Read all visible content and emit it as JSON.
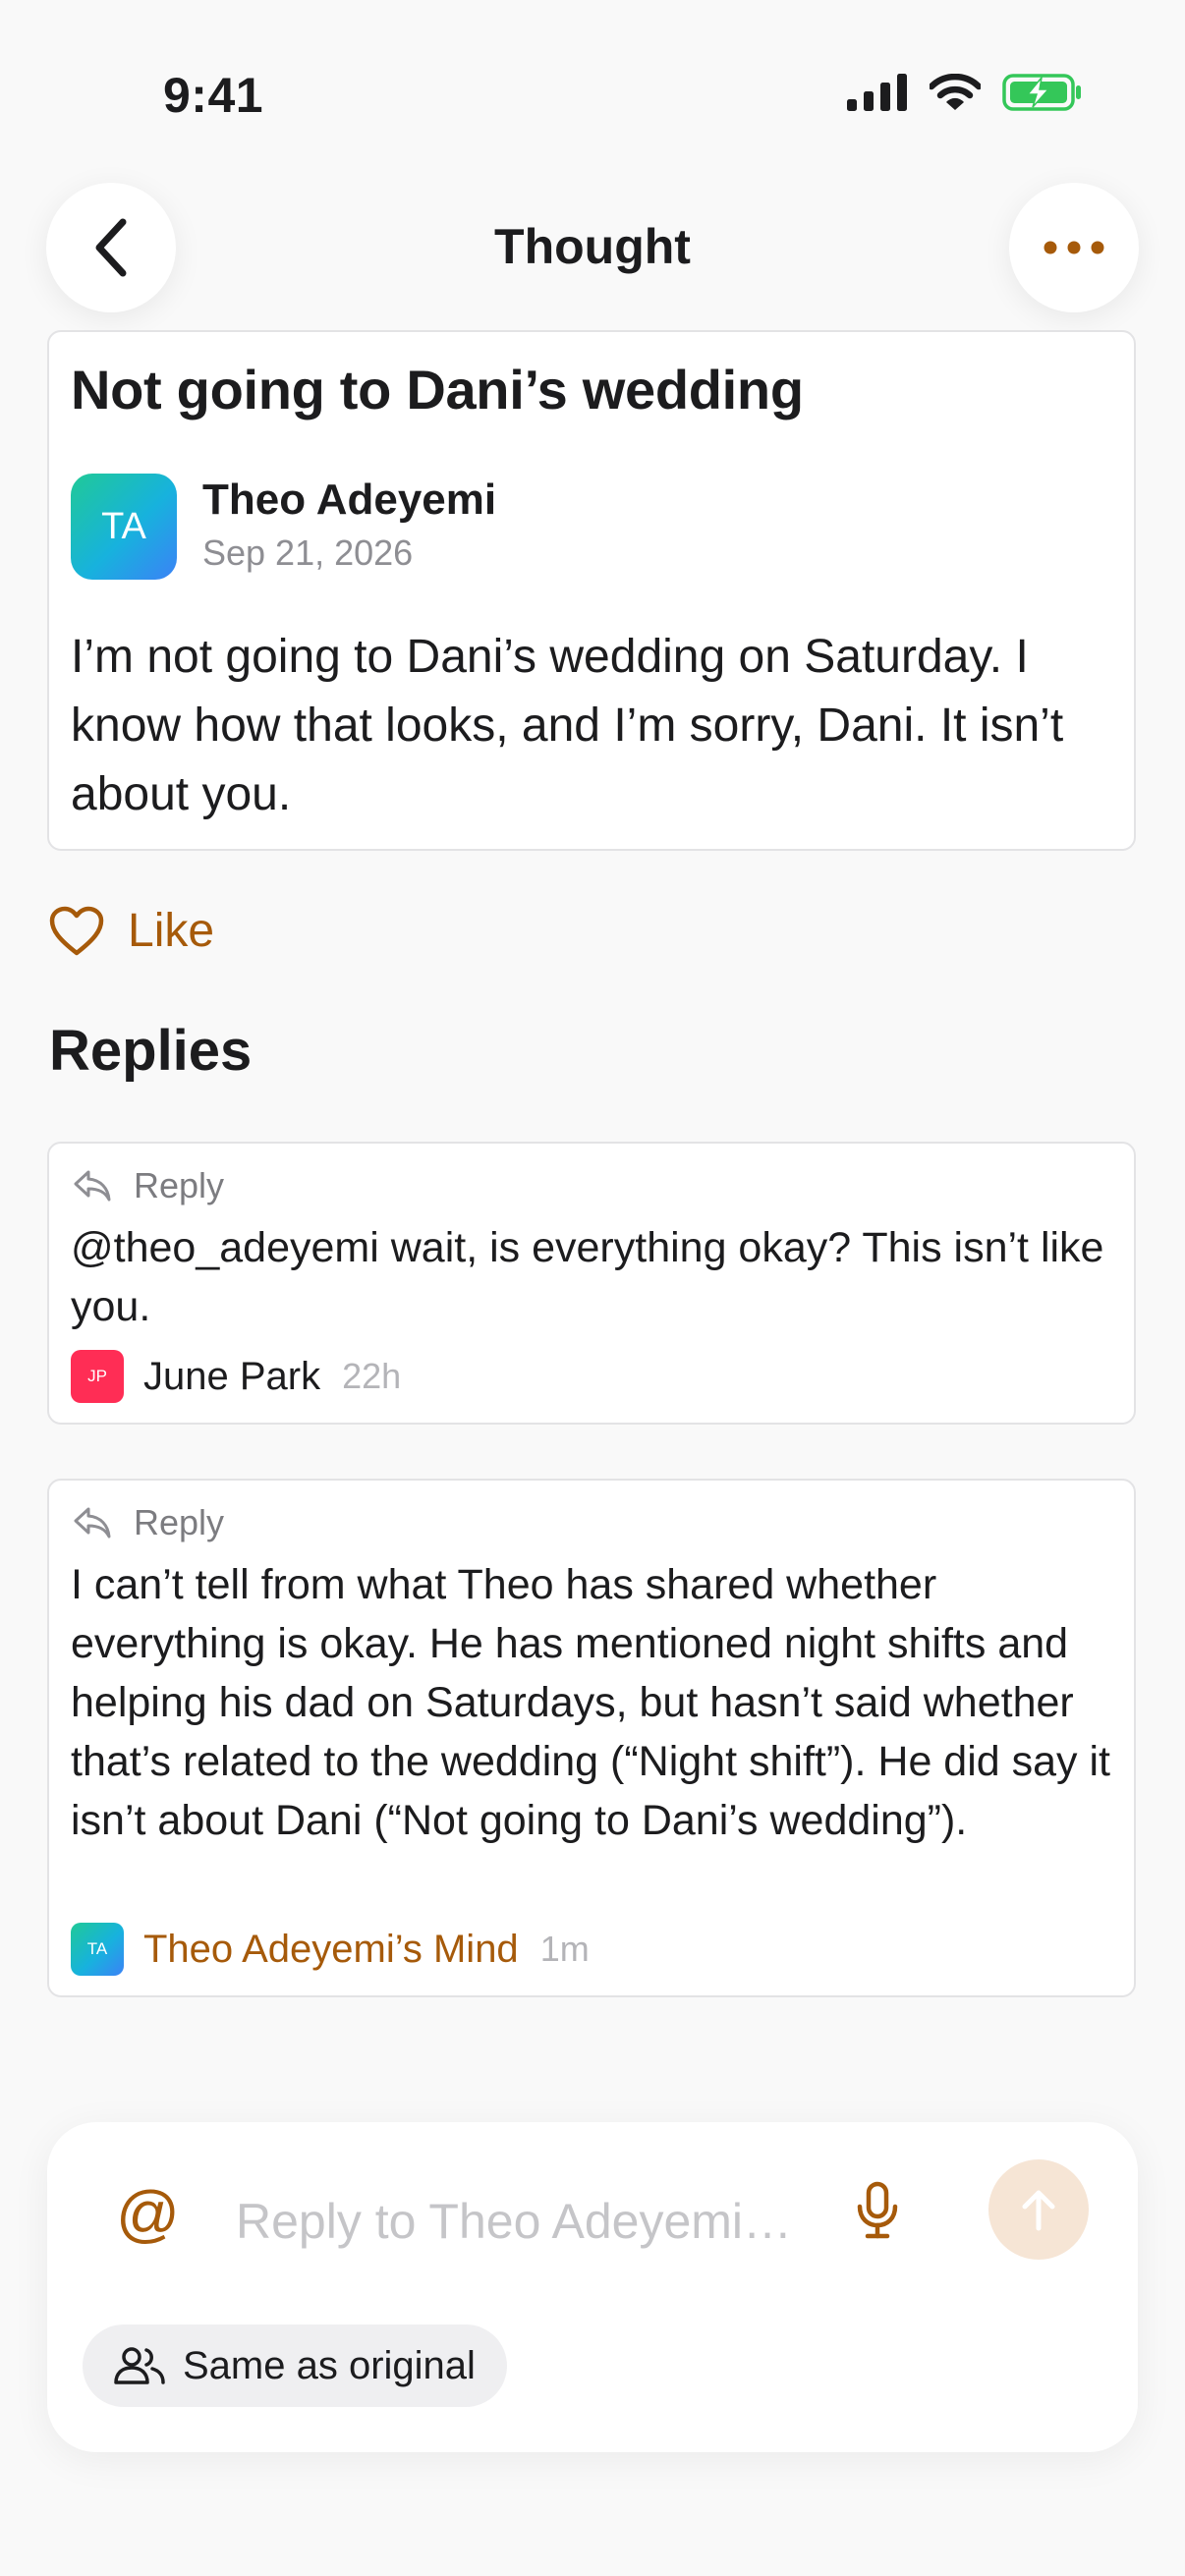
{
  "status_bar": {
    "time": "9:41"
  },
  "nav": {
    "title": "Thought"
  },
  "thought": {
    "title": "Not going to Dani’s wedding",
    "author": {
      "initials": "TA",
      "name": "Theo Adeyemi",
      "date": "Sep 21, 2026"
    },
    "body": "I’m not going to Dani’s wedding on Saturday. I know how that looks, and I’m sorry, Dani. It isn’t about you."
  },
  "like": {
    "label": "Like"
  },
  "replies": {
    "heading": "Replies",
    "items": [
      {
        "tag": "Reply",
        "text": "@theo_adeyemi wait, is everything okay? This isn’t like you.",
        "initials": "JP",
        "name": "June Park",
        "time": "22h"
      },
      {
        "tag": "Reply",
        "text": "I can’t tell from what Theo has shared whether everything is okay. He has mentioned night shifts and helping his dad on Saturdays, but hasn’t said whether that’s related to the wedding (“Night shift”). He did say it isn’t about Dani (“Not going to Dani’s wedding”).",
        "initials": "TA",
        "name": "Theo Adeyemi’s Mind",
        "time": "1m"
      }
    ]
  },
  "composer": {
    "at_symbol": "@",
    "placeholder": "Reply to Theo Adeyemi…",
    "audience_label": "Same as original"
  },
  "colors": {
    "accent": "#a65a0a",
    "send_disabled": "#f6e5d5",
    "battery_green": "#34c759",
    "jp_avatar": "#ff2d55"
  },
  "icons": [
    "back-chevron-icon",
    "more-dots-icon",
    "heart-icon",
    "reply-arrow-icon",
    "microphone-icon",
    "arrow-up-icon",
    "people-icon",
    "signal-icon",
    "wifi-icon",
    "battery-charging-icon"
  ]
}
